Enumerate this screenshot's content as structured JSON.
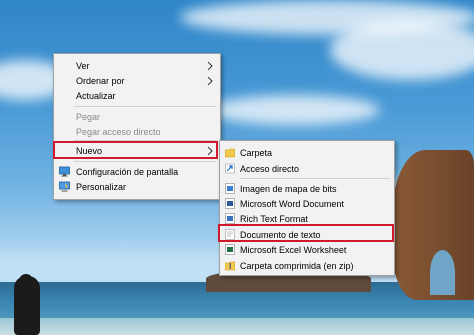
{
  "context_menu": {
    "items": [
      {
        "label": "Ver"
      },
      {
        "label": "Ordenar por"
      },
      {
        "label": "Actualizar"
      },
      {
        "label": "Pegar"
      },
      {
        "label": "Pegar acceso directo"
      },
      {
        "label": "Nuevo"
      },
      {
        "label": "Configuración de pantalla"
      },
      {
        "label": "Personalizar"
      }
    ]
  },
  "submenu_nuevo": {
    "items": [
      {
        "label": "Carpeta"
      },
      {
        "label": "Acceso directo"
      },
      {
        "label": "Imagen de mapa de bits"
      },
      {
        "label": "Microsoft Word Document"
      },
      {
        "label": "Rich Text Format"
      },
      {
        "label": "Documento de texto"
      },
      {
        "label": "Microsoft Excel Worksheet"
      },
      {
        "label": "Carpeta comprimida (en zip)"
      }
    ]
  },
  "colors": {
    "highlight_border": "#d0192b",
    "menu_background": "#f2f2f2",
    "disabled_text": "#8a8a8a"
  }
}
